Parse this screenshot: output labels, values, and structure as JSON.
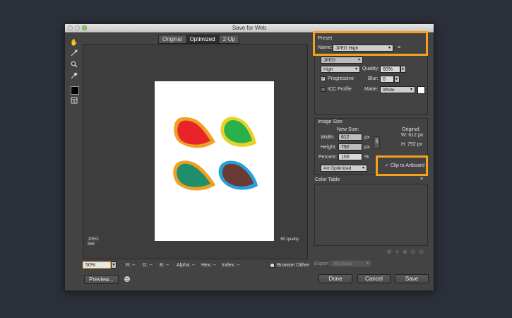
{
  "window": {
    "title": "Save for Web"
  },
  "tools": [
    "hand-icon",
    "slice-select-icon",
    "zoom-icon",
    "eyedropper-icon",
    "eyedropper-color-icon",
    "toggle-slices-icon"
  ],
  "view_tabs": [
    {
      "label": "Original",
      "active": false
    },
    {
      "label": "Optimized",
      "active": true
    },
    {
      "label": "2-Up",
      "active": false
    }
  ],
  "preview_info": {
    "format": "JPEG",
    "size": "55K",
    "quality_note": "60 quality"
  },
  "zoom": {
    "value": "50%",
    "readouts": [
      "R: --",
      "G: --",
      "B: --",
      "Alpha: --",
      "Hex: --",
      "Index: --"
    ]
  },
  "browser_dither": {
    "label": "Browser Dither",
    "checked": false
  },
  "buttons": {
    "preview": "Preview...",
    "done": "Done",
    "cancel": "Cancel",
    "save": "Save"
  },
  "preset": {
    "title": "Preset",
    "name_label": "Name:",
    "name_value": "JPEG High",
    "format_value": "JPEG",
    "compression_value": "High",
    "quality_label": "Quality:",
    "quality_value": "60%",
    "progressive_label": "Progressive",
    "progressive_checked": true,
    "blur_label": "Blur:",
    "blur_value": "0",
    "icc_label": "ICC Profile",
    "icc_checked": false,
    "matte_label": "Matte:",
    "matte_value": "White"
  },
  "image_size": {
    "title": "Image Size",
    "new_size_label": "New Size:",
    "original_label": "Original:",
    "width_label": "Width:",
    "width_value": "612",
    "height_label": "Height:",
    "height_value": "792",
    "percent_label": "Percent:",
    "percent_value": "100",
    "unit_px": "px",
    "unit_pct": "%",
    "orig_w": "W:  612 px",
    "orig_h": "H:  792 px",
    "quality_method": "Art Optimized",
    "clip_label": "Clip to Artboard",
    "clip_checked": true
  },
  "color_table": {
    "title": "Color Table"
  },
  "export": {
    "label": "Export:",
    "value": "All Slices"
  },
  "colors": {
    "highlight": "#f4a21b",
    "background": "#2b2f3a",
    "panel": "#434343"
  }
}
